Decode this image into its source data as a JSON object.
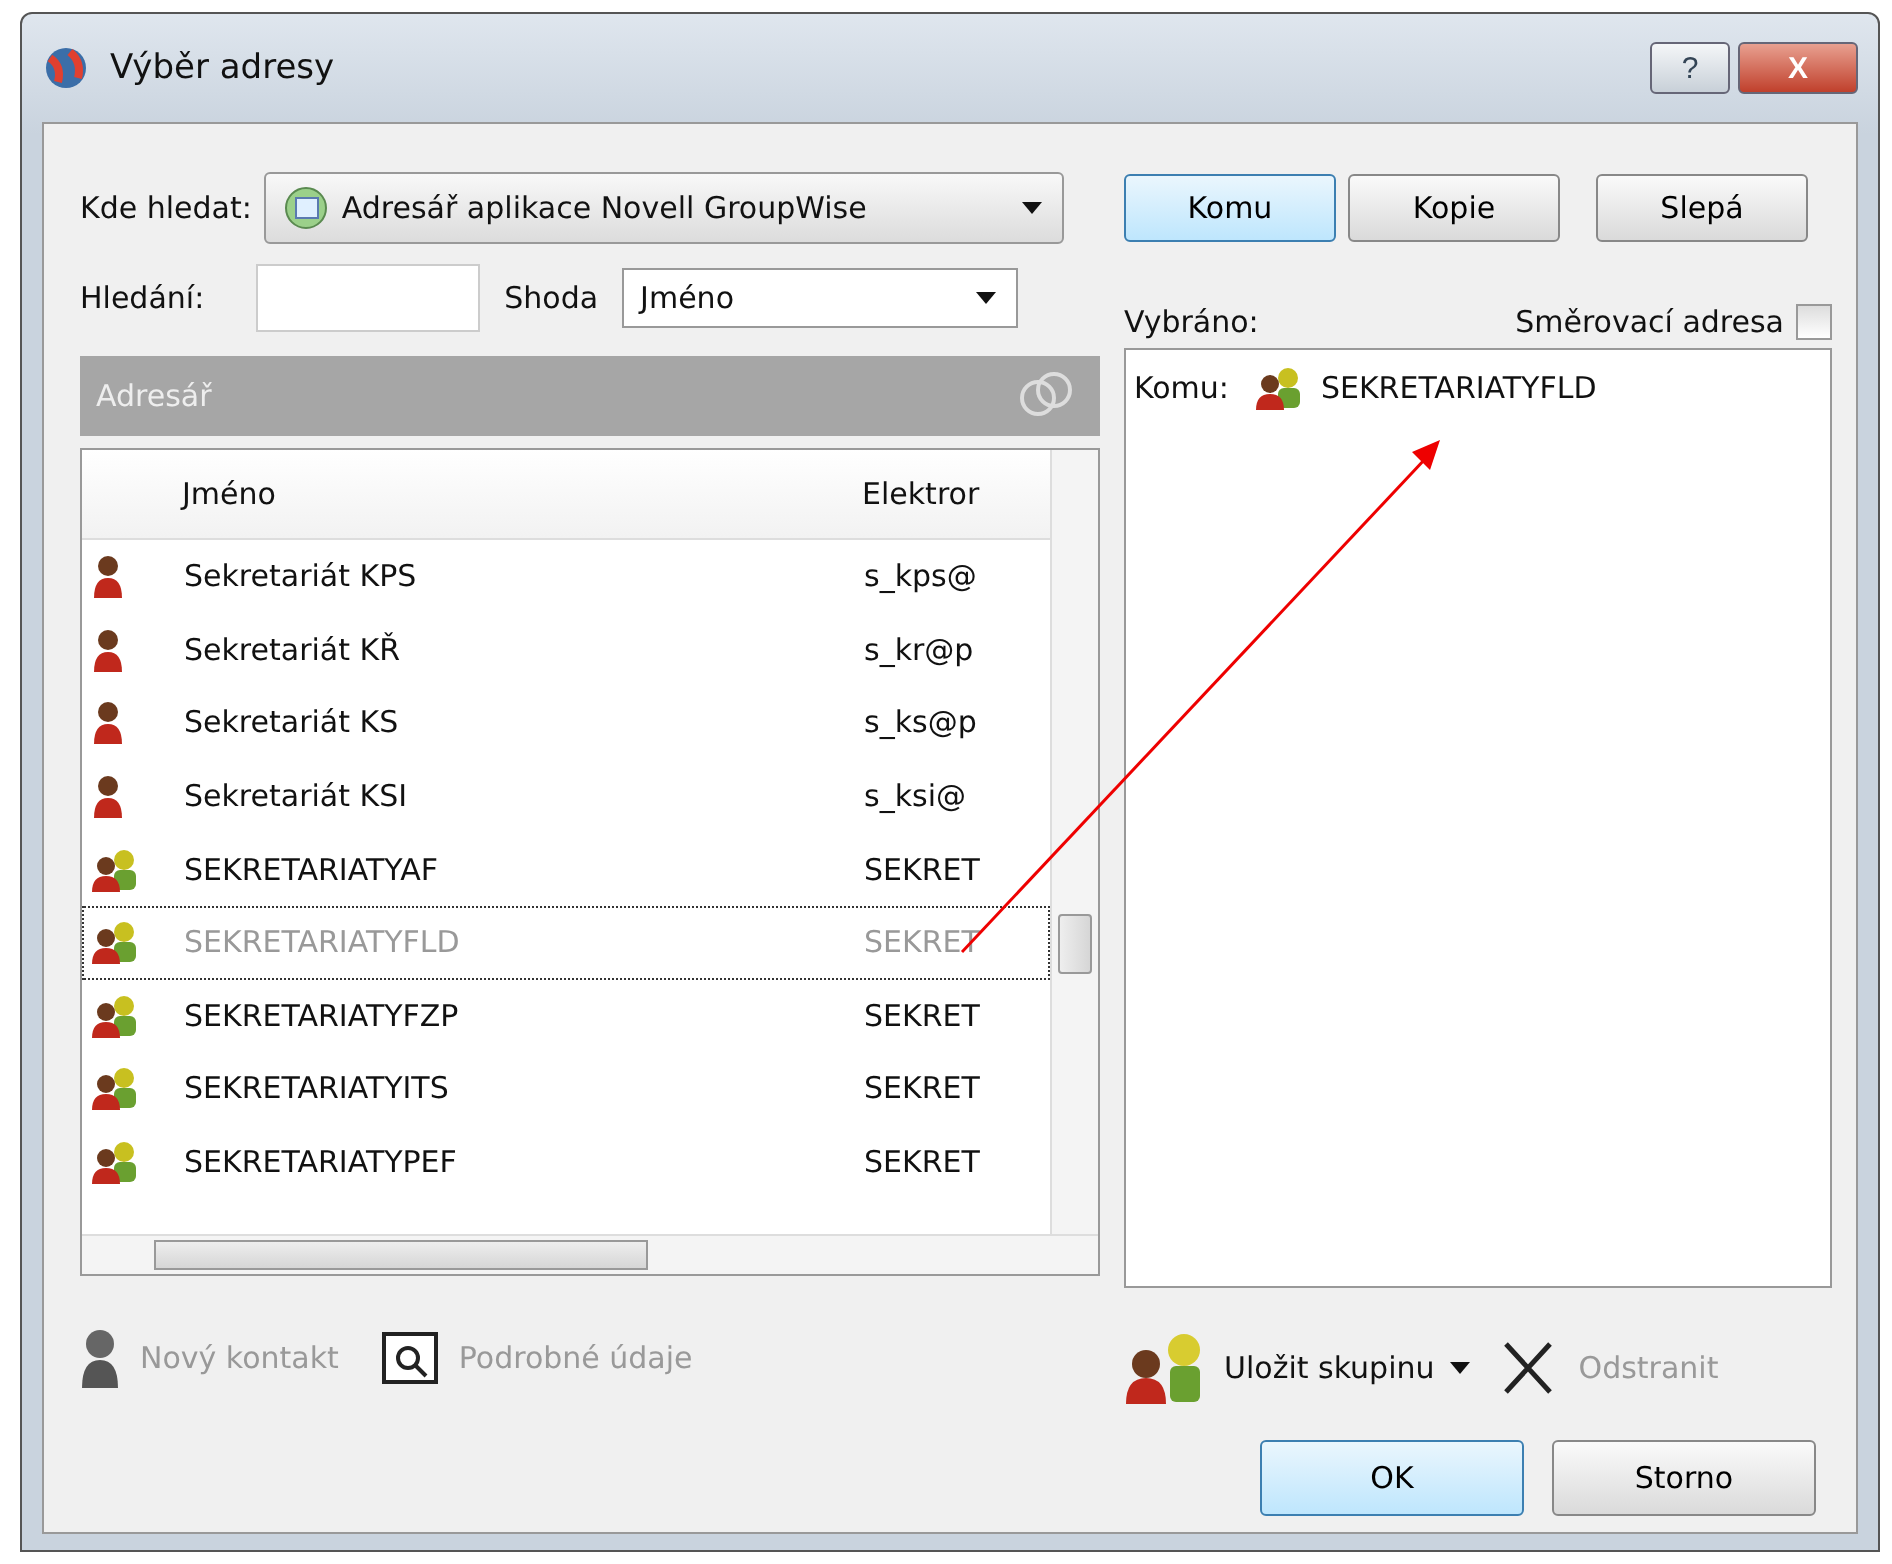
{
  "window": {
    "title": "Výběr adresy",
    "help_button": "?",
    "close_button": "X"
  },
  "look_in": {
    "label": "Kde hledat:",
    "value": "Adresář aplikace Novell GroupWise"
  },
  "search": {
    "label": "Hledání:",
    "match_label": "Shoda",
    "match_value": "Jméno"
  },
  "recipient_buttons": [
    {
      "label": "Komu",
      "selected": true
    },
    {
      "label": "Kopie",
      "selected": false
    },
    {
      "label": "Slepá",
      "selected": false
    }
  ],
  "address_book": {
    "title": "Adresář",
    "columns": [
      "Jméno",
      "Elektror"
    ],
    "rows": [
      {
        "kind": "person",
        "name": "Sekretariát KPS",
        "email": "s_kps@",
        "selected": false
      },
      {
        "kind": "person",
        "name": "Sekretariát KŘ",
        "email": "s_kr@p",
        "selected": false
      },
      {
        "kind": "person",
        "name": "Sekretariát KS",
        "email": "s_ks@p",
        "selected": false
      },
      {
        "kind": "person",
        "name": "Sekretariát KSI",
        "email": "s_ksi@",
        "selected": false
      },
      {
        "kind": "group",
        "name": "SEKRETARIATYAF",
        "email": "SEKRET",
        "selected": false
      },
      {
        "kind": "group",
        "name": "SEKRETARIATYFLD",
        "email": "SEKRET",
        "selected": true
      },
      {
        "kind": "group",
        "name": "SEKRETARIATYFZP",
        "email": "SEKRET",
        "selected": false
      },
      {
        "kind": "group",
        "name": "SEKRETARIATYITS",
        "email": "SEKRET",
        "selected": false
      },
      {
        "kind": "group",
        "name": "SEKRETARIATYPEF",
        "email": "SEKRET",
        "selected": false
      }
    ],
    "actions": [
      "Nový kontakt",
      "Podrobné údaje"
    ]
  },
  "selected_panel": {
    "label": "Vybráno:",
    "routing_label": "Směrovací adresa",
    "routing_checked": false,
    "entries": [
      {
        "prefix": "Komu:",
        "kind": "group",
        "name": "SEKRETARIATYFLD"
      }
    ],
    "actions": [
      "Uložit skupinu",
      "Odstranit"
    ]
  },
  "buttons": [
    "OK",
    "Storno"
  ]
}
